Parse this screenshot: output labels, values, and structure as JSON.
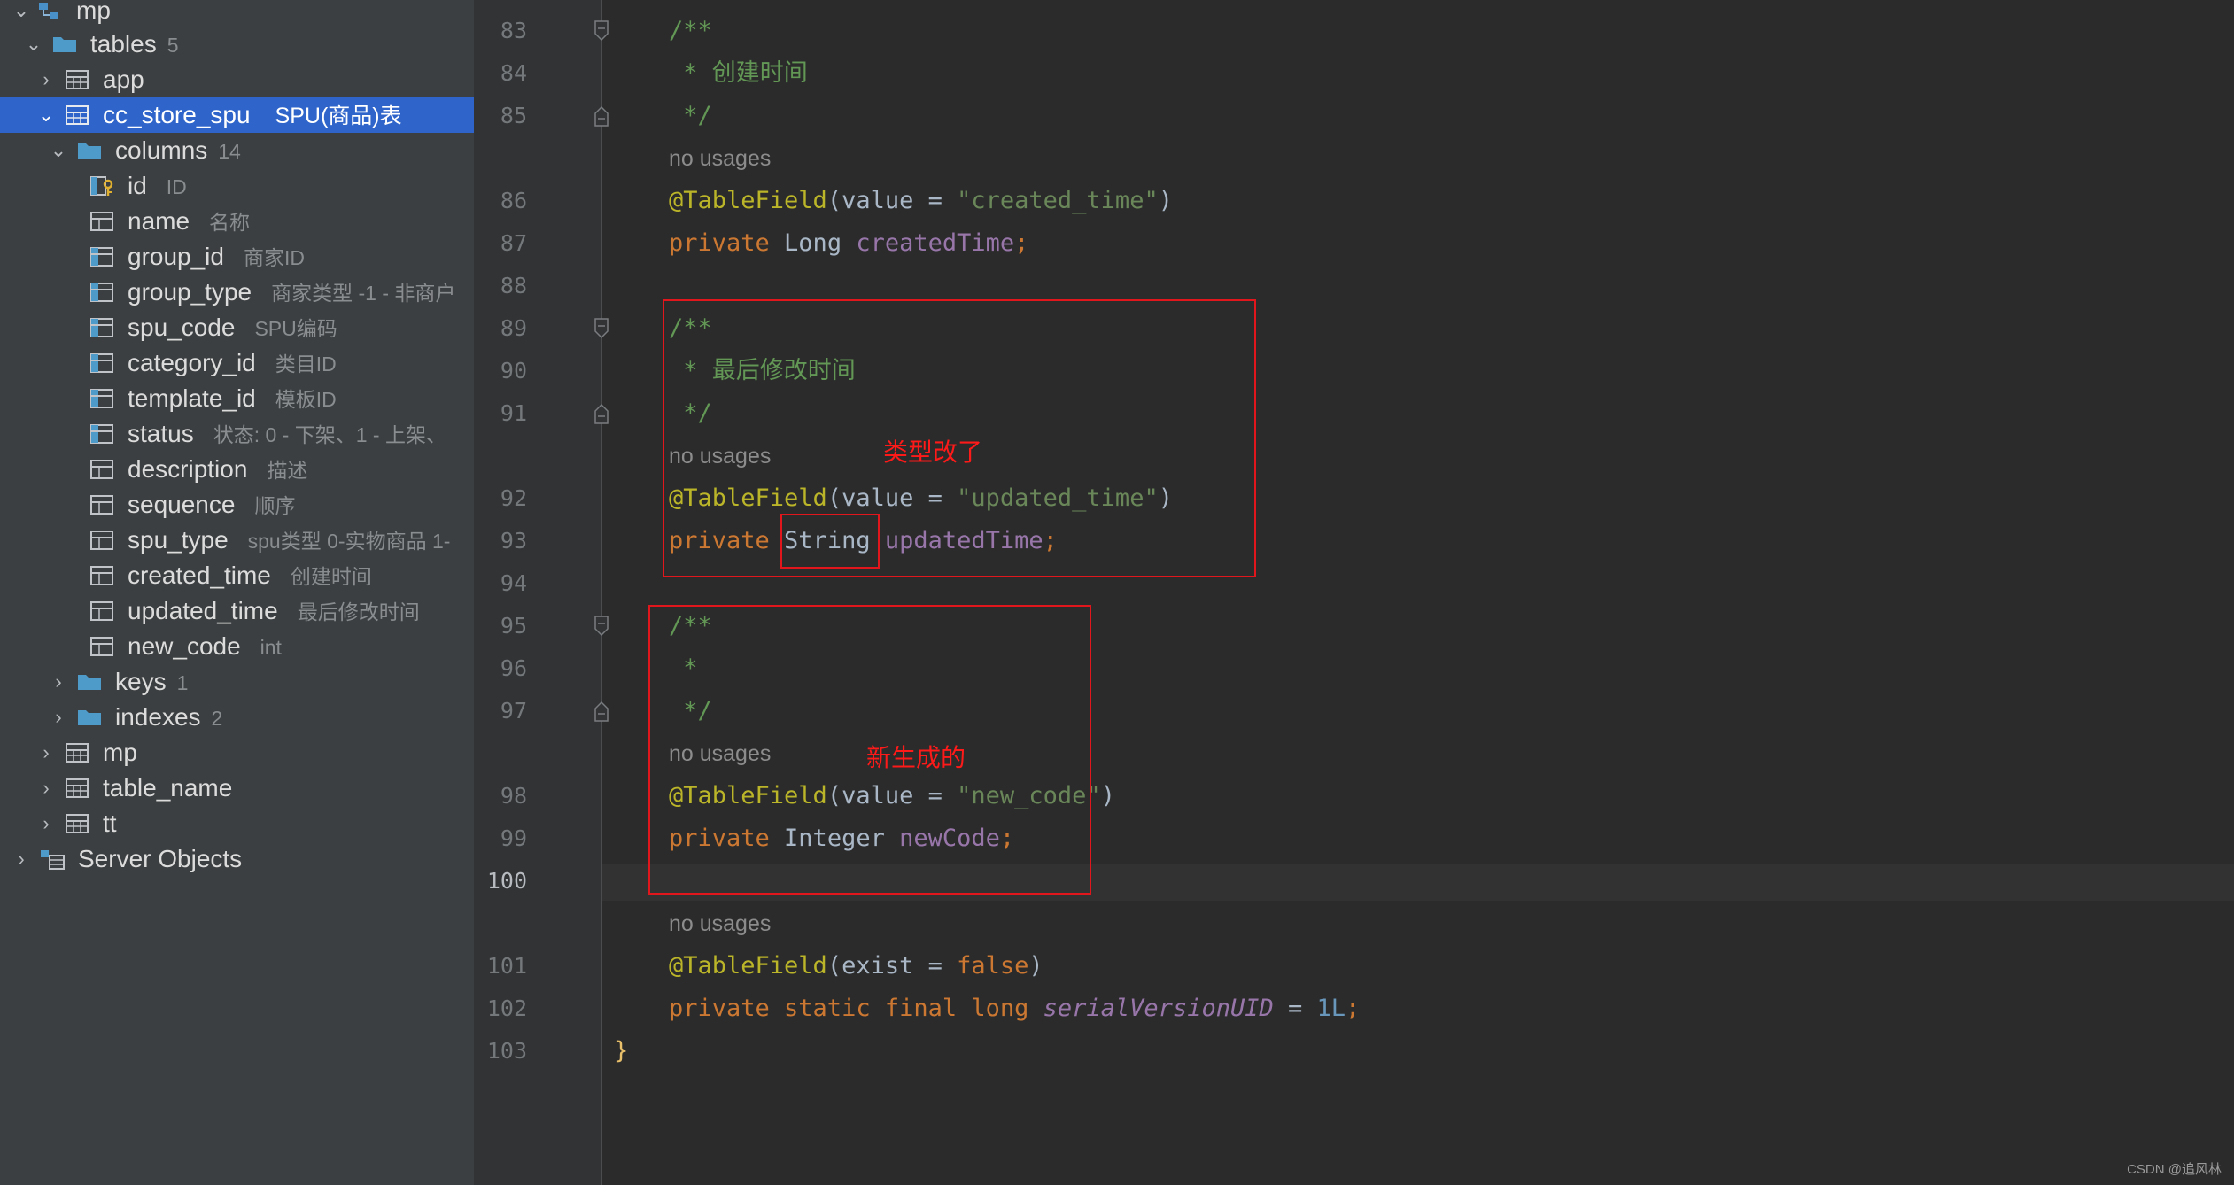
{
  "tree": {
    "root_label": "mp",
    "tables_label": "tables",
    "tables_count": "5",
    "app_label": "app",
    "selected_table": {
      "label": "cc_store_spu",
      "comment": "SPU(商品)表"
    },
    "columns_label": "columns",
    "columns_count": "14",
    "columns": [
      {
        "name": "id",
        "comment": "ID"
      },
      {
        "name": "name",
        "comment": "名称"
      },
      {
        "name": "group_id",
        "comment": "商家ID"
      },
      {
        "name": "group_type",
        "comment": "商家类型 -1 - 非商户"
      },
      {
        "name": "spu_code",
        "comment": "SPU编码"
      },
      {
        "name": "category_id",
        "comment": "类目ID"
      },
      {
        "name": "template_id",
        "comment": "模板ID"
      },
      {
        "name": "status",
        "comment": "状态: 0 - 下架、1 - 上架、"
      },
      {
        "name": "description",
        "comment": "描述"
      },
      {
        "name": "sequence",
        "comment": "顺序"
      },
      {
        "name": "spu_type",
        "comment": "spu类型 0-实物商品 1-"
      },
      {
        "name": "created_time",
        "comment": "创建时间"
      },
      {
        "name": "updated_time",
        "comment": "最后修改时间"
      },
      {
        "name": "new_code",
        "comment": "int"
      }
    ],
    "keys_label": "keys",
    "keys_count": "1",
    "indexes_label": "indexes",
    "indexes_count": "2",
    "other_tables": [
      "mp",
      "table_name",
      "tt"
    ],
    "server_objects_label": "Server Objects"
  },
  "editor": {
    "line_numbers": [
      "83",
      "84",
      "85",
      "86",
      "87",
      "88",
      "89",
      "90",
      "91",
      "92",
      "93",
      "94",
      "95",
      "96",
      "97",
      "98",
      "99",
      "100",
      "101",
      "102",
      "103"
    ],
    "current_line": "100",
    "hint_no_usages": "no usages",
    "lines": {
      "l83": "/**",
      "l84": " * 创建时间",
      "l85": " */",
      "l86_ann": "@TableField",
      "l86_open": "(value = ",
      "l86_str": "\"created_time\"",
      "l86_close": ")",
      "l87_kw": "private ",
      "l87_type": "Long ",
      "l87_field": "createdTime",
      "l87_semi": ";",
      "l89": "/**",
      "l90": " * 最后修改时间",
      "l91": " */",
      "l92_ann": "@TableField",
      "l92_open": "(value = ",
      "l92_str": "\"updated_time\"",
      "l92_close": ")",
      "l93_kw": "private ",
      "l93_type": "String",
      "l93_field": " updatedTime",
      "l93_semi": ";",
      "l95": "/**",
      "l96": " *",
      "l97": " */",
      "l98_ann": "@TableField",
      "l98_open": "(value = ",
      "l98_str": "\"new_code\"",
      "l98_close": ")",
      "l99_kw": "private ",
      "l99_type": "Integer ",
      "l99_field": "newCode",
      "l99_semi": ";",
      "l101_ann": "@TableField",
      "l101_open": "(exist = ",
      "l101_kw": "false",
      "l101_close": ")",
      "l102_kw": "private static final long ",
      "l102_field": "serialVersionUID",
      "l102_eq": " = ",
      "l102_num": "1L",
      "l102_semi": ";",
      "l103": "}"
    }
  },
  "annotations": {
    "type_changed": "类型改了",
    "newly_generated": "新生成的"
  },
  "watermark": "CSDN @追风林",
  "colors": {
    "sidebar_bg": "#3c3f41",
    "selection": "#2f65ca",
    "editor_bg": "#2b2b2b",
    "annotation_red": "#e0161c"
  }
}
